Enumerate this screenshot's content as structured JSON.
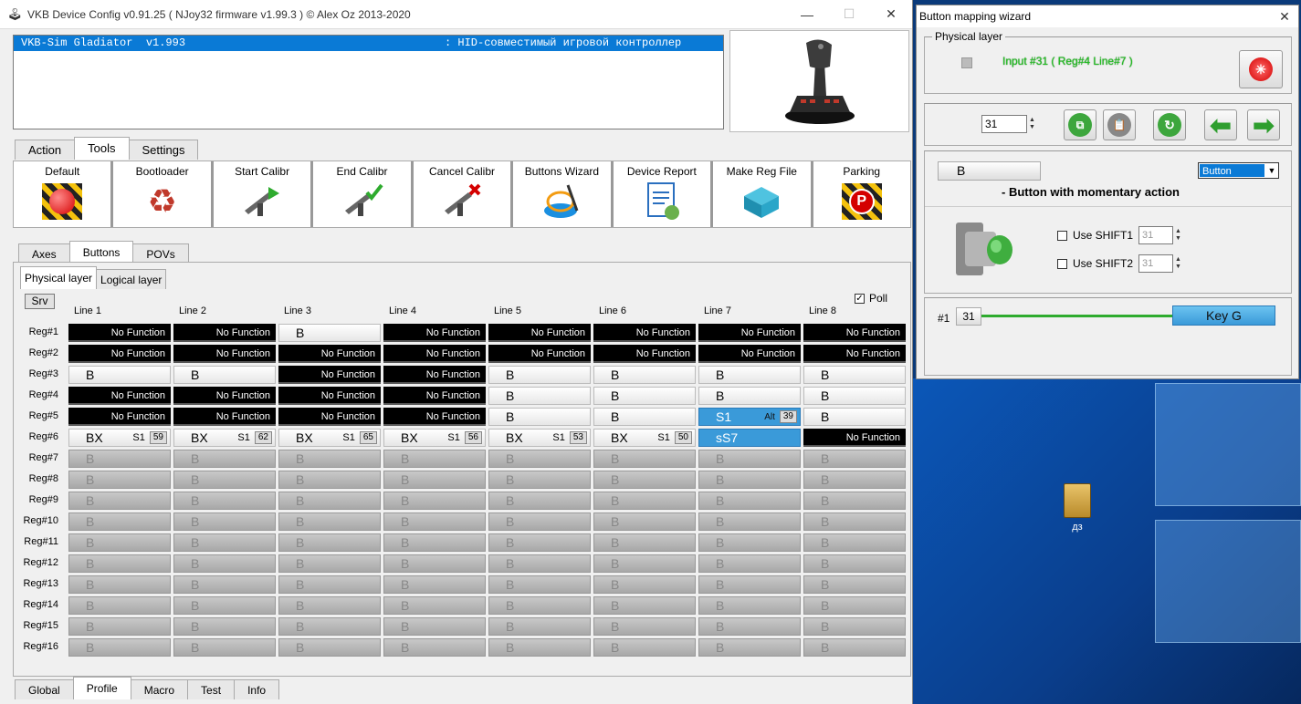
{
  "main": {
    "title": "VKB Device Config v0.91.25 ( NJoy32 firmware v1.99.3 ) © Alex Oz 2013-2020",
    "device": {
      "name": "VKB-Sim Gladiator  v1.993",
      "desc": ": HID-совместимый игровой контроллер"
    },
    "top_tabs": [
      "Action",
      "Tools",
      "Settings"
    ],
    "tools": [
      {
        "label": "Default",
        "icon": "default-red-button-icon"
      },
      {
        "label": "Bootloader",
        "icon": "recycle-icon"
      },
      {
        "label": "Start Calibr",
        "icon": "caliper-play-icon"
      },
      {
        "label": "End Calibr",
        "icon": "caliper-check-icon"
      },
      {
        "label": "Cancel Calibr",
        "icon": "caliper-cancel-icon"
      },
      {
        "label": "Buttons Wizard",
        "icon": "wizard-wand-icon"
      },
      {
        "label": "Device Report",
        "icon": "report-document-icon"
      },
      {
        "label": "Make Reg File",
        "icon": "registry-cube-icon"
      },
      {
        "label": "Parking",
        "icon": "parking-icon"
      }
    ],
    "sub_tabs": [
      "Axes",
      "Buttons",
      "POVs"
    ],
    "layer_tabs": [
      "Physical layer",
      "Logical layer"
    ],
    "srv": "Srv",
    "poll": "Poll",
    "lines": [
      "Line 1",
      "Line 2",
      "Line 3",
      "Line 4",
      "Line 5",
      "Line 6",
      "Line 7",
      "Line 8"
    ],
    "regs": [
      "Reg#1",
      "Reg#2",
      "Reg#3",
      "Reg#4",
      "Reg#5",
      "Reg#6",
      "Reg#7",
      "Reg#8",
      "Reg#9",
      "Reg#10",
      "Reg#11",
      "Reg#12",
      "Reg#13",
      "Reg#14",
      "Reg#15",
      "Reg#16"
    ],
    "grid": [
      [
        [
          "nf",
          "No Function"
        ],
        [
          "nf",
          "No Function"
        ],
        [
          "b",
          "B"
        ],
        [
          "nf",
          "No Function"
        ],
        [
          "nf",
          "No Function"
        ],
        [
          "nf",
          "No Function"
        ],
        [
          "nf",
          "No Function"
        ],
        [
          "nf",
          "No Function"
        ]
      ],
      [
        [
          "nf",
          "No Function"
        ],
        [
          "nf",
          "No Function"
        ],
        [
          "nf",
          "No Function"
        ],
        [
          "nf",
          "No Function"
        ],
        [
          "nf",
          "No Function"
        ],
        [
          "nf",
          "No Function"
        ],
        [
          "nf",
          "No Function"
        ],
        [
          "nf",
          "No Function"
        ]
      ],
      [
        [
          "b",
          "B"
        ],
        [
          "b",
          "B"
        ],
        [
          "nf",
          "No Function"
        ],
        [
          "nf",
          "No Function"
        ],
        [
          "b",
          "B"
        ],
        [
          "b",
          "B"
        ],
        [
          "b",
          "B"
        ],
        [
          "b",
          "B"
        ]
      ],
      [
        [
          "nf",
          "No Function"
        ],
        [
          "nf",
          "No Function"
        ],
        [
          "nf",
          "No Function"
        ],
        [
          "nf",
          "No Function"
        ],
        [
          "b",
          "B"
        ],
        [
          "b",
          "B"
        ],
        [
          "b",
          "B"
        ],
        [
          "b",
          "B"
        ]
      ],
      [
        [
          "nf",
          "No Function"
        ],
        [
          "nf",
          "No Function"
        ],
        [
          "nf",
          "No Function"
        ],
        [
          "nf",
          "No Function"
        ],
        [
          "b",
          "B"
        ],
        [
          "b",
          "B"
        ],
        [
          "s1",
          "S1",
          "Alt",
          "39"
        ],
        [
          "b",
          "B"
        ]
      ],
      [
        [
          "bx",
          "BX",
          "S1",
          "59"
        ],
        [
          "bx",
          "BX",
          "S1",
          "62"
        ],
        [
          "bx",
          "BX",
          "S1",
          "65"
        ],
        [
          "bx",
          "BX",
          "S1",
          "56"
        ],
        [
          "bx",
          "BX",
          "S1",
          "53"
        ],
        [
          "bx",
          "BX",
          "S1",
          "50"
        ],
        [
          "ss",
          "sS7"
        ],
        [
          "nf",
          "No Function"
        ]
      ]
    ],
    "empty_label": "B",
    "bottom_tabs": [
      "Global",
      "Profile",
      "Macro",
      "Test",
      "Info"
    ]
  },
  "wizard": {
    "title": "Button mapping wizard",
    "physical_layer": "Physical layer",
    "input_info": "Input #31  ( Reg#4  Line#7 )",
    "number": "31",
    "button_label": "B",
    "type_select": "Button",
    "description": "- Button with momentary action",
    "shift1": "Use SHIFT1",
    "shift2": "Use SHIFT2",
    "shift1_val": "31",
    "shift2_val": "31",
    "map_index": "#1",
    "map_num": "31",
    "key": "Key G"
  },
  "desktop": {
    "icon_label": "дз"
  }
}
